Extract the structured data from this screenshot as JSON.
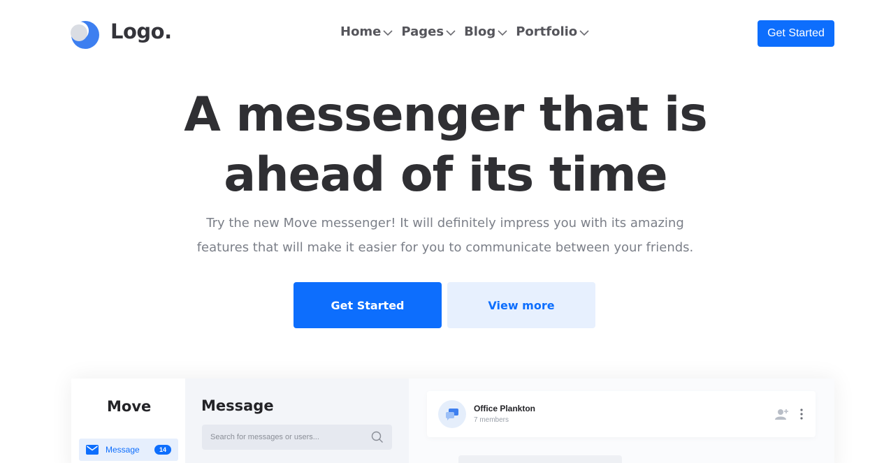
{
  "header": {
    "logo_text": "Logo.",
    "nav": [
      {
        "label": "Home"
      },
      {
        "label": "Pages"
      },
      {
        "label": "Blog"
      },
      {
        "label": "Portfolio"
      }
    ],
    "cta_label": "Get Started"
  },
  "hero": {
    "title_line1": "A messenger that is",
    "title_line2": "ahead of its time",
    "subtitle_line1": "Try the new Move messenger! It will definitely impress you with its amazing",
    "subtitle_line2": "features that will make it easier for you to communicate between your friends.",
    "primary_button": "Get Started",
    "secondary_button": "View more"
  },
  "app_preview": {
    "brand": "Move",
    "nav_item": {
      "label": "Message",
      "badge": "14",
      "icon": "mail-icon"
    },
    "list_title": "Message",
    "search_placeholder": "Search for messages or users...",
    "chat": {
      "name": "Office Plankton",
      "members": "7 members"
    }
  },
  "colors": {
    "accent": "#0d6efd",
    "accent_light": "#e7f0fe",
    "text_dark": "#2f2f33",
    "text_muted": "#7b7f88"
  }
}
